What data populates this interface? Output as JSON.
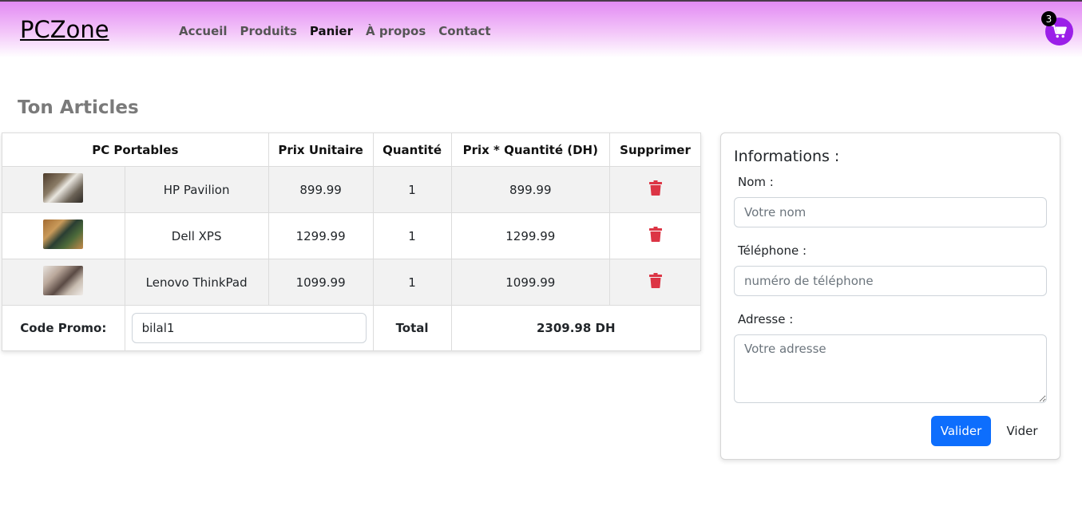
{
  "navbar": {
    "brand": "PCZone",
    "links": [
      "Accueil",
      "Produits",
      "Panier",
      "À propos",
      "Contact"
    ],
    "active": "Panier",
    "cart_count": "3",
    "accent_color": "#9b1fe8"
  },
  "page": {
    "title": "Ton Articles"
  },
  "cart": {
    "headers": [
      "PC Portables",
      "Prix Unitaire",
      "Quantité",
      "Prix * Quantité (DH)",
      "Supprimer"
    ],
    "items": [
      {
        "name": "HP Pavilion",
        "unit_price": "899.99",
        "quantity": "1",
        "total": "899.99",
        "delete_icon": "trash-icon"
      },
      {
        "name": "Dell XPS",
        "unit_price": "1299.99",
        "quantity": "1",
        "total": "1299.99",
        "delete_icon": "trash-icon"
      },
      {
        "name": "Lenovo ThinkPad",
        "unit_price": "1099.99",
        "quantity": "1",
        "total": "1099.99",
        "delete_icon": "trash-icon"
      }
    ],
    "promo_label": "Code Promo:",
    "promo_value": "bilal1",
    "total_label": "Total",
    "total_value": "2309.98 DH",
    "delete_color": "#dc3545"
  },
  "info": {
    "title": "Informations :",
    "name_label": "Nom :",
    "name_placeholder": "Votre nom",
    "phone_label": "Téléphone :",
    "phone_placeholder": "numéro de téléphone",
    "address_label": "Adresse :",
    "address_placeholder": "Votre adresse",
    "submit_label": "Valider",
    "clear_label": "Vider",
    "submit_color": "#0d6efd"
  }
}
